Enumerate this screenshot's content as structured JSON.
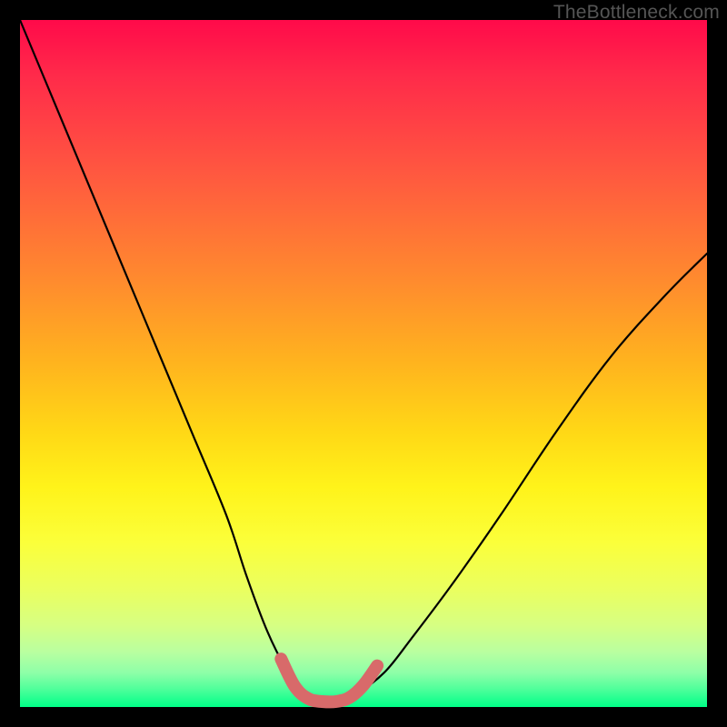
{
  "watermark": "TheBottleneck.com",
  "colors": {
    "frame": "#000000",
    "curve_stroke": "#000000",
    "highlight_stroke": "#d86a6a"
  },
  "chart_data": {
    "type": "line",
    "title": "",
    "xlabel": "",
    "ylabel": "",
    "xlim": [
      0,
      100
    ],
    "ylim": [
      0,
      100
    ],
    "series": [
      {
        "name": "bottleneck-curve",
        "x": [
          0,
          5,
          10,
          15,
          20,
          25,
          30,
          33,
          36,
          39,
          41,
          43,
          46,
          49,
          53,
          57,
          63,
          70,
          78,
          86,
          94,
          100
        ],
        "y": [
          100,
          88,
          76,
          64,
          52,
          40,
          28,
          19,
          11,
          5,
          2,
          1,
          1,
          2,
          5,
          10,
          18,
          28,
          40,
          51,
          60,
          66
        ]
      }
    ],
    "highlight": {
      "name": "bottom-segment",
      "x": [
        38,
        40,
        42,
        44,
        46,
        48,
        50,
        52
      ],
      "y": [
        7,
        3,
        1.2,
        0.8,
        0.8,
        1.4,
        3.2,
        6
      ]
    },
    "background_gradient": {
      "top": "#ff0a4a",
      "mid": "#fff31a",
      "bottom": "#00ff88"
    }
  }
}
